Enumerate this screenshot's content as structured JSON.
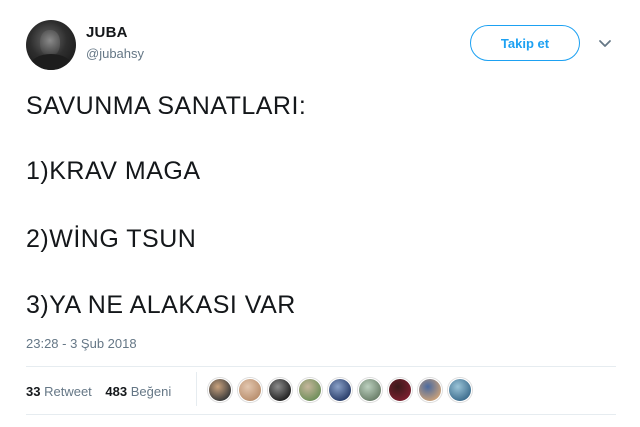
{
  "author": {
    "display_name": "JUBA",
    "handle": "@jubahsy"
  },
  "follow_button": {
    "label": "Takip et"
  },
  "tweet": {
    "lines": [
      "SAVUNMA SANATLARI:",
      "1)KRAV MAGA",
      "2)WİNG TSUN",
      "3)YA NE ALAKASI VAR"
    ],
    "timestamp": "23:28 - 3 Şub 2018"
  },
  "stats": {
    "retweet_count": "33",
    "retweet_label": "Retweet",
    "like_count": "483",
    "like_label": "Beğeni"
  },
  "likers": [
    {
      "colors": [
        "#3a3a3a",
        "#c9a27e"
      ]
    },
    {
      "colors": [
        "#b98f6e",
        "#e3c7b0"
      ]
    },
    {
      "colors": [
        "#222222",
        "#8c8c8c"
      ]
    },
    {
      "colors": [
        "#6f8f5a",
        "#c6b69c"
      ]
    },
    {
      "colors": [
        "#2a3e6a",
        "#8aa1c8"
      ]
    },
    {
      "colors": [
        "#6b7f6a",
        "#bcd0bf"
      ]
    },
    {
      "colors": [
        "#7a1f2e",
        "#3a1a1a"
      ]
    },
    {
      "colors": [
        "#c8a07a",
        "#4a6aa0"
      ]
    },
    {
      "colors": [
        "#3e6e8e",
        "#9bc4d8"
      ]
    }
  ]
}
